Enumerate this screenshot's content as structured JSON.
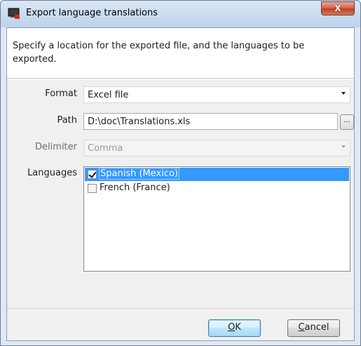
{
  "window": {
    "title": "Export language translations",
    "close_label": "X"
  },
  "header": {
    "instruction": "Specify a location for the exported file, and the languages to be exported."
  },
  "form": {
    "format": {
      "label": "Format",
      "value": "Excel file"
    },
    "path": {
      "label": "Path",
      "value": "D:\\doc\\Translations.xls",
      "browse_label": "..."
    },
    "delimiter": {
      "label": "Delimiter",
      "value": "Comma",
      "disabled": true
    },
    "languages": {
      "label": "Languages",
      "items": [
        {
          "label": "Spanish (Mexico)",
          "checked": true,
          "selected": true
        },
        {
          "label": "French (France)",
          "checked": false,
          "selected": false
        }
      ]
    }
  },
  "footer": {
    "ok_mnemonic": "O",
    "ok_rest": "K",
    "cancel_mnemonic": "C",
    "cancel_rest": "ancel"
  },
  "colors": {
    "selection": "#3399ff",
    "close_button": "#c2401f",
    "default_button_border": "#3c7fb1"
  },
  "icons": {
    "app": "monitor-app-icon",
    "close": "close-icon",
    "dropdown": "chevron-down-icon",
    "browse": "ellipsis-icon"
  }
}
